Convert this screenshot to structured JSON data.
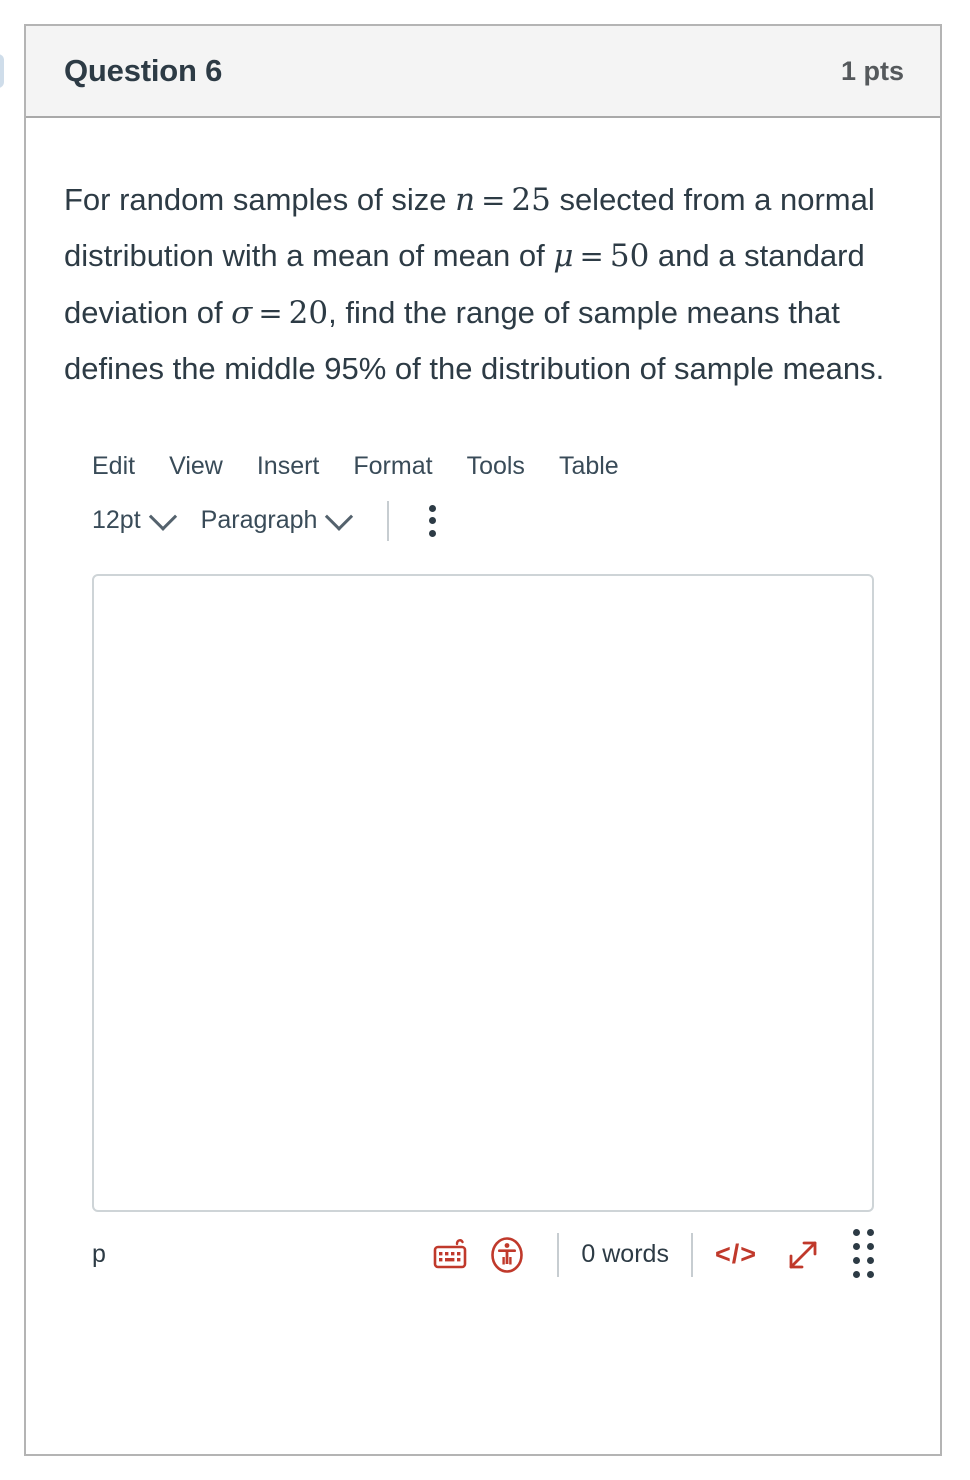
{
  "question": {
    "title": "Question 6",
    "points": "1 pts",
    "text_segments": [
      {
        "type": "text",
        "value": "For random samples of size "
      },
      {
        "type": "mathvar",
        "value": "n"
      },
      {
        "type": "matheq",
        "value": "="
      },
      {
        "type": "mathnum",
        "value": "25"
      },
      {
        "type": "text",
        "value": " selected from a normal distribution with a mean of mean of "
      },
      {
        "type": "mathvar",
        "value": "μ"
      },
      {
        "type": "matheq",
        "value": "="
      },
      {
        "type": "mathnum",
        "value": "50"
      },
      {
        "type": "text",
        "value": " and a standard deviation of "
      },
      {
        "type": "mathvar",
        "value": "σ"
      },
      {
        "type": "matheq",
        "value": "="
      },
      {
        "type": "mathnum",
        "value": "20"
      },
      {
        "type": "text",
        "value": ", find the range of sample means that defines the middle 95% of the distribution of sample means."
      }
    ],
    "plain_text": "For random samples of size n = 25 selected from a normal distribution with a mean of mean of μ = 50 and a standard deviation of σ = 20, find the range of sample means that defines the middle 95% of the distribution of sample means."
  },
  "editor": {
    "menubar": [
      {
        "label": "Edit",
        "name": "menu-edit"
      },
      {
        "label": "View",
        "name": "menu-view"
      },
      {
        "label": "Insert",
        "name": "menu-insert"
      },
      {
        "label": "Format",
        "name": "menu-format"
      },
      {
        "label": "Tools",
        "name": "menu-tools"
      },
      {
        "label": "Table",
        "name": "menu-table"
      }
    ],
    "toolbar": {
      "font_size": "12pt",
      "block_format": "Paragraph",
      "more_options_icon": "kebab-vertical-icon"
    },
    "content": {
      "value": "",
      "placeholder": ""
    },
    "statusbar": {
      "element_path": "p",
      "word_count": "0 words",
      "keyboard_shortcuts_icon": "keyboard-icon",
      "accessibility_icon": "accessibility-checker-icon",
      "html_editor_label": "</>",
      "fullscreen_icon": "expand-diagonal-arrows-icon",
      "resize_handle_icon": "resize-grip-icon"
    }
  },
  "colors": {
    "accent_red": "#c0392b",
    "header_bg": "#f4f4f4",
    "card_border": "#b4b4b4",
    "text": "#2d3b45",
    "muted_text": "#55595c",
    "divider": "#c7cdd1"
  }
}
